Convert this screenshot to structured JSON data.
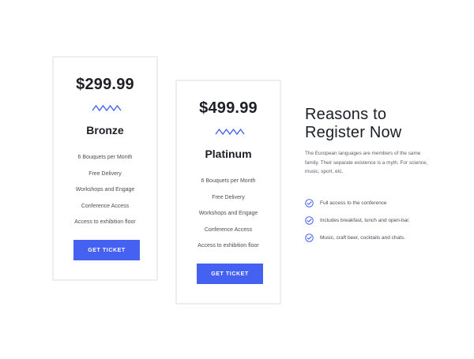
{
  "colors": {
    "accent": "#4461f2",
    "card_border": "#eceef2",
    "heading": "#1c1f26",
    "text": "#4a4e57"
  },
  "plans": [
    {
      "price": "$299.99",
      "name": "Bronze",
      "features": [
        "6 Bouquets per Month",
        "Free Delivery",
        "Workshops and Engage",
        "Conference Access",
        "Access to exhibition floor"
      ],
      "button_label": "GET TICKET"
    },
    {
      "price": "$499.99",
      "name": "Platinum",
      "features": [
        "6 Bouquets per Month",
        "Free Delivery",
        "Workshops and Engage",
        "Conference Access",
        "Access to exhibition floor"
      ],
      "button_label": "GET TICKET"
    }
  ],
  "reasons": {
    "title_line1": "Reasons to",
    "title_line2": "Register Now",
    "description": "The European languages are members of the same family. Their separate existence is a myth. For science, music, sport, etc.",
    "items": [
      "Full access to the conference",
      "Includes breakfast, lunch and open-bar.",
      "Music, craft beer, cocktails and chats."
    ]
  }
}
